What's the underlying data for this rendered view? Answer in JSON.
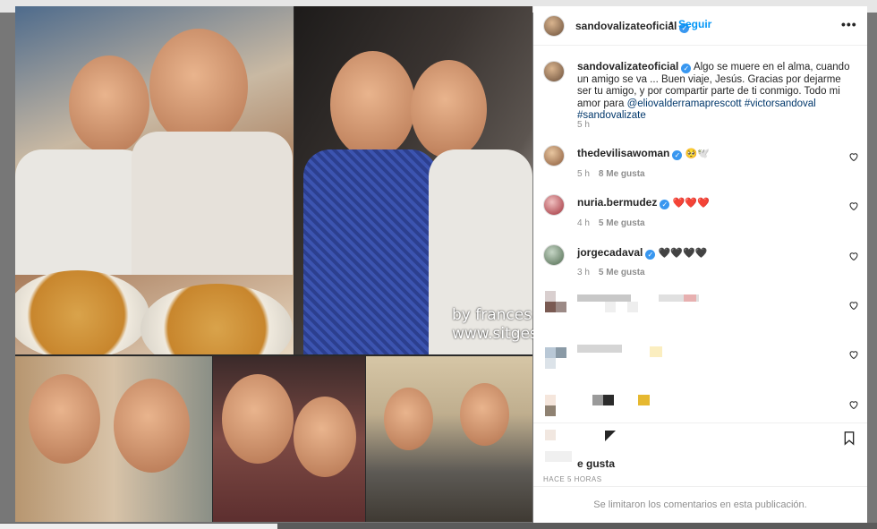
{
  "post": {
    "username": "sandovalizateoficial",
    "follow_label": "Seguir",
    "separator": "•",
    "more_label": "•••",
    "caption_user": "sandovalizateoficial",
    "caption_text": "Algo se muere en el alma, cuando un amigo se va ... Buen viaje, Jesús. Gracias por dejarme ser tu amigo, y por compartir parte de ti conmigo. Todo mi amor para ",
    "caption_mention": "@eliovalderramaprescott",
    "caption_hashtag1": "#victorsandoval",
    "caption_hashtag2": "#sandovalizate",
    "caption_age": "5 h",
    "watermark_line1": "by frances",
    "watermark_line2": "www.sitges",
    "likes_label": "e gusta",
    "timestamp": "HACE 5 HORAS",
    "comments_limited": "Se limitaron los comentarios en esta publicación."
  },
  "comments": [
    {
      "user": "thedevilisawoman",
      "text": "🥺🕊️",
      "age": "5 h",
      "likes": "8 Me gusta"
    },
    {
      "user": "nuria.bermudez",
      "text": "❤️❤️❤️",
      "age": "4 h",
      "likes": "5 Me gusta"
    },
    {
      "user": "jorgecadaval",
      "text": "🖤🖤🖤🖤",
      "age": "3 h",
      "likes": "5 Me gusta"
    }
  ],
  "icons": {
    "verified": "verified-badge-icon",
    "heart": "heart-icon",
    "bookmark": "bookmark-icon",
    "more": "more-options-icon"
  },
  "colors": {
    "accent": "#0095f6",
    "verified": "#3897f0",
    "text": "#262626",
    "muted": "#8e8e8e",
    "link": "#00376b"
  }
}
